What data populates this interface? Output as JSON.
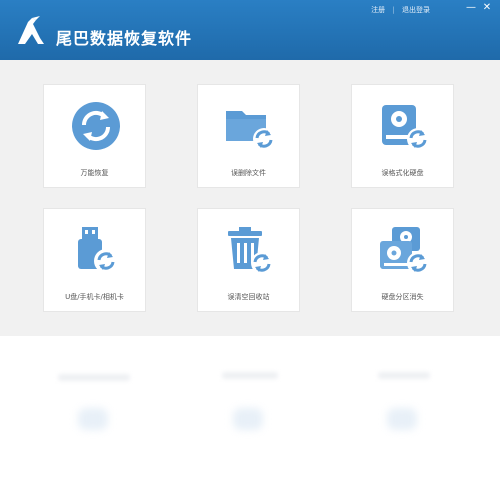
{
  "app": {
    "title": "尾巴数据恢复软件"
  },
  "header_links": {
    "register": "注册",
    "register_code": "退出登录"
  },
  "window_controls": {
    "minimize": "—",
    "close": "✕"
  },
  "accent_color": "#2677bf",
  "icon_color": "#5b9bd5",
  "cards": [
    {
      "label": "万能恢复",
      "icon": "recover-icon"
    },
    {
      "label": "误删除文件",
      "icon": "deleted-file-icon"
    },
    {
      "label": "误格式化硬盘",
      "icon": "format-disk-icon"
    },
    {
      "label": "U盘/手机卡/相机卡",
      "icon": "usb-card-icon"
    },
    {
      "label": "误清空回收站",
      "icon": "recycle-bin-icon"
    },
    {
      "label": "硬盘分区消失",
      "icon": "partition-lost-icon"
    }
  ]
}
